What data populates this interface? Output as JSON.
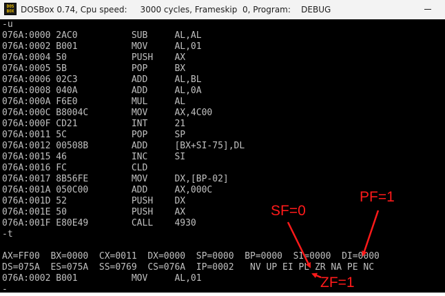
{
  "window": {
    "title": "DOSBox 0.74, Cpu speed:     3000 cycles, Frameskip  0, Program:    DEBUG",
    "icon_text": "DOS BOX",
    "icon": "dosbox-icon"
  },
  "console": {
    "lines": [
      "-u",
      "076A:0000 2AC0          SUB     AL,AL",
      "076A:0002 B001          MOV     AL,01",
      "076A:0004 50            PUSH    AX",
      "076A:0005 5B            POP     BX",
      "076A:0006 02C3          ADD     AL,BL",
      "076A:0008 040A          ADD     AL,0A",
      "076A:000A F6E0          MUL     AL",
      "076A:000C B8004C        MOV     AX,4C00",
      "076A:000F CD21          INT     21",
      "076A:0011 5C            POP     SP",
      "076A:0012 00508B        ADD     [BX+SI-75],DL",
      "076A:0015 46            INC     SI",
      "076A:0016 FC            CLD",
      "076A:0017 8B56FE        MOV     DX,[BP-02]",
      "076A:001A 050C00        ADD     AX,000C",
      "076A:001D 52            PUSH    DX",
      "076A:001E 50            PUSH    AX",
      "076A:001F E80E49        CALL    4930",
      "-t",
      "",
      "AX=FF00  BX=0000  CX=0011  DX=0000  SP=0000  BP=0000  SI=0000  DI=0000",
      "DS=075A  ES=075A  SS=0769  CS=076A  IP=0002   NV UP EI PL ZR NA PE NC",
      "076A:0002 B001          MOV     AL,01",
      "-"
    ]
  },
  "annotations": {
    "color": "#ff1a1a",
    "sf_label": "SF=0",
    "pf_label": "PF=1",
    "zf_label": "ZF=1"
  }
}
